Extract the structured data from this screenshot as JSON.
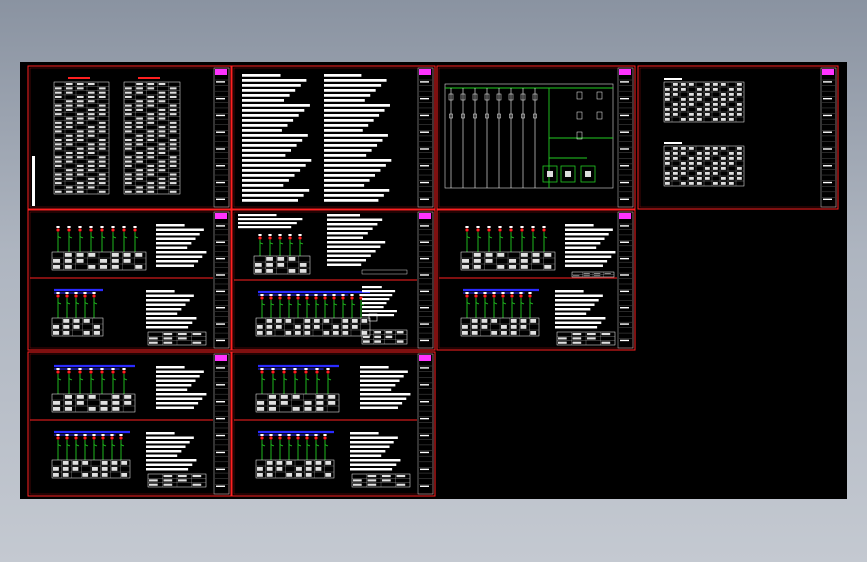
{
  "viewer": {
    "background_top": "#8a93a1",
    "background_bottom": "#c4c9d1",
    "canvas_color": "#000000"
  },
  "colors": {
    "frame": "#ff2020",
    "wire": "#22cc22",
    "bus": "#2a2aff",
    "text": "#ffffff",
    "accent": "#ff33ff"
  },
  "sheets": [
    {
      "id": "material-tables",
      "kind": "tables"
    },
    {
      "id": "design-notes",
      "kind": "notes"
    },
    {
      "id": "system-diagram",
      "kind": "system"
    },
    {
      "id": "schedule-tables",
      "kind": "schedule"
    },
    {
      "id": "distribution-1",
      "kind": "dist"
    },
    {
      "id": "distribution-2",
      "kind": "dist"
    },
    {
      "id": "distribution-3",
      "kind": "dist"
    },
    {
      "id": "distribution-4",
      "kind": "dist"
    },
    {
      "id": "distribution-5",
      "kind": "dist"
    }
  ]
}
